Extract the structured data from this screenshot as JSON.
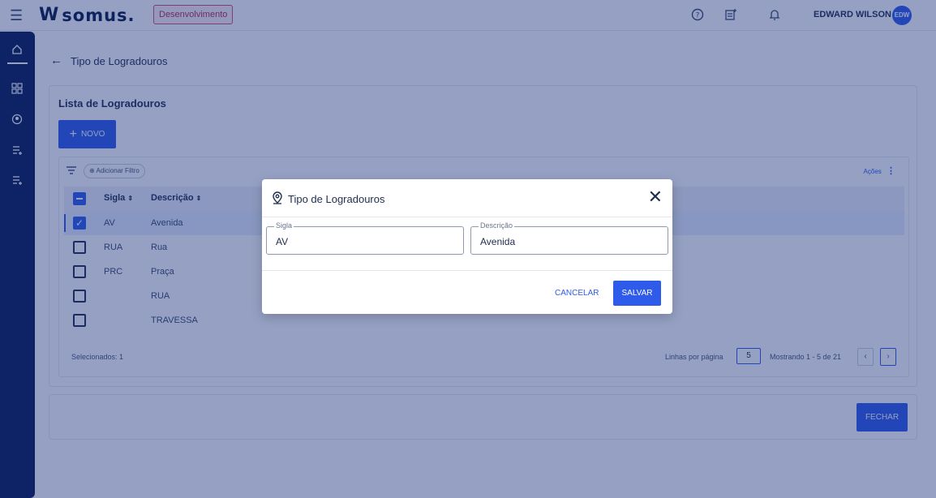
{
  "topbar": {
    "brand_mark": "W",
    "brand_name": "somus.",
    "env_badge": "Desenvolvimento",
    "user_name": "EDWARD WILSON",
    "avatar_initials": "EDW",
    "icons": [
      "help-circle-icon",
      "news-icon",
      "bell-icon"
    ]
  },
  "sidebar": {
    "icons": [
      "home-icon",
      "dashboard-icon",
      "location-icon",
      "list-icon",
      "list-add-icon"
    ]
  },
  "page": {
    "back_icon": "←",
    "title": "Tipo de Logradouros"
  },
  "list": {
    "title": "Lista de Logradouros",
    "new_button": "NOVO",
    "add_filter": "Adicionar Filtro",
    "actions_label": "Ações",
    "columns": [
      "Sigla",
      "Descrição"
    ],
    "rows": [
      {
        "sigla": "AV",
        "descricao": "Avenida",
        "checked": true
      },
      {
        "sigla": "RUA",
        "descricao": "Rua",
        "checked": false
      },
      {
        "sigla": "PRC",
        "descricao": "Praça",
        "checked": false
      },
      {
        "sigla": "",
        "descricao": "RUA",
        "checked": false
      },
      {
        "sigla": "",
        "descricao": "TRAVESSA",
        "checked": false
      }
    ],
    "selected_count": "Selecionados: 1",
    "rows_per_page_label": "Linhas por página",
    "rows_per_page_value": "5",
    "showing": "Mostrando 1 - 5 de 21",
    "prev_label": "‹",
    "next_label": "›"
  },
  "footer": {
    "close_button": "FECHAR"
  },
  "modal": {
    "title": "Tipo de Logradouros",
    "close_symbol": "✕",
    "sigla_label": "Sigla",
    "sigla_value": "AV",
    "descricao_label": "Descrição",
    "descricao_value": "Avenida",
    "cancel_button": "CANCELAR",
    "save_button": "SALVAR"
  },
  "colors": {
    "primary": "#2f5bea",
    "sidebar": "#0a1d57",
    "overlay": "#152c79",
    "env_badge": "#d2506a"
  }
}
